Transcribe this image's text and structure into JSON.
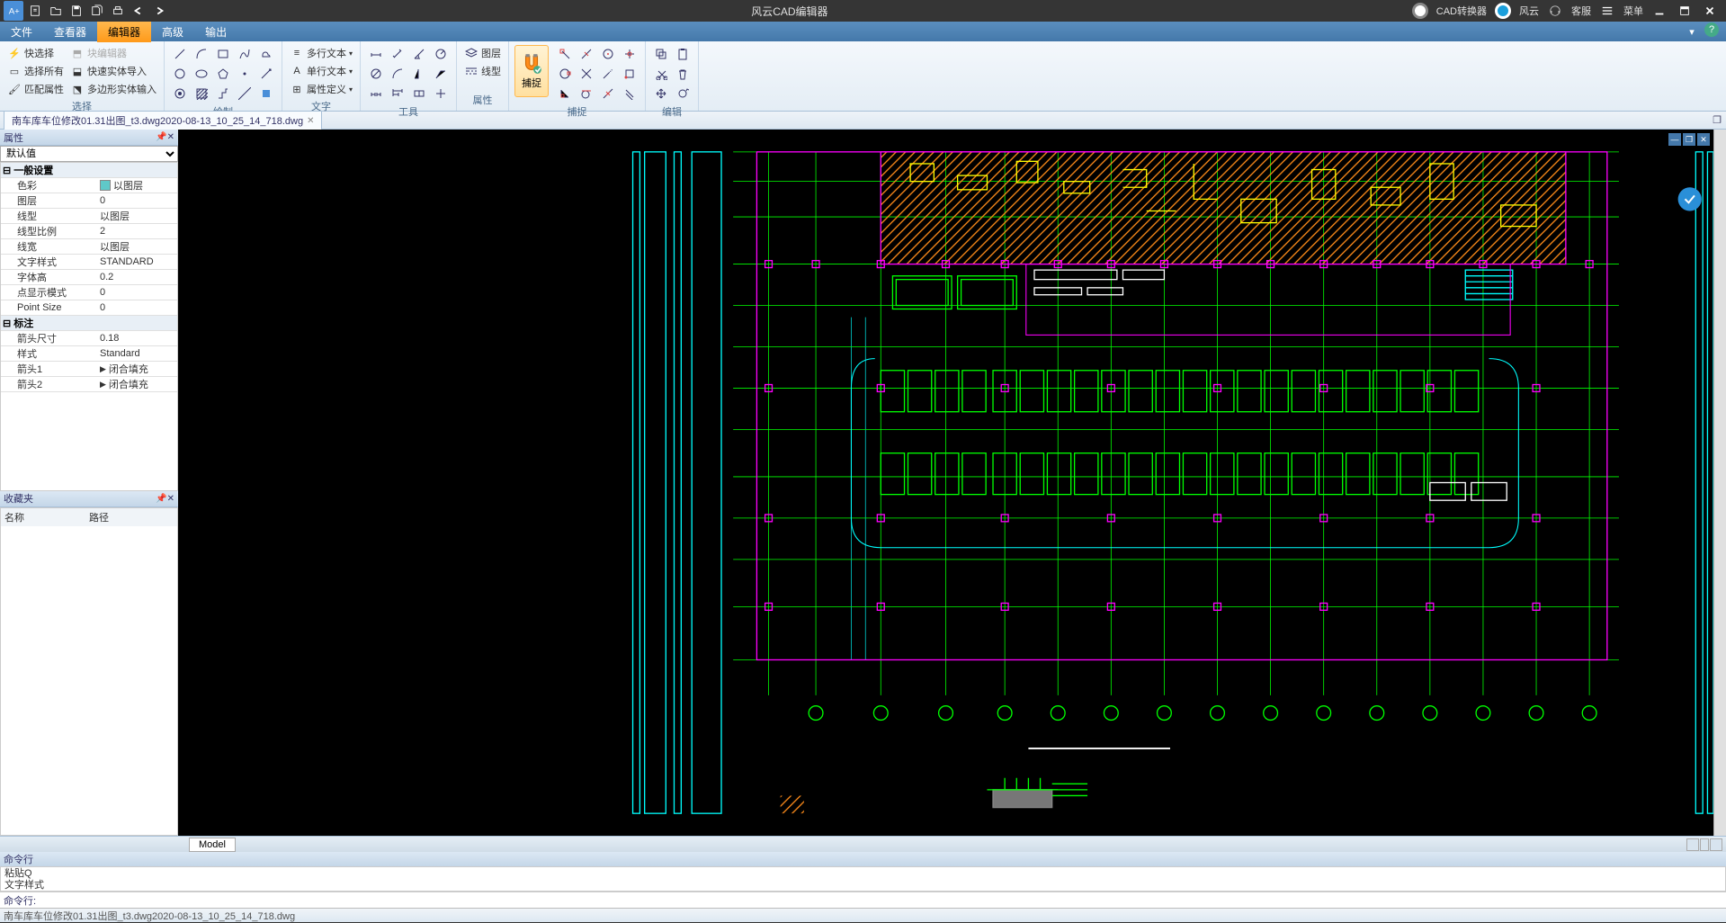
{
  "app": {
    "title": "风云CAD编辑器"
  },
  "titlebar_right": {
    "convert": "CAD转换器",
    "brand": "风云",
    "support": "客服",
    "menu": "菜单"
  },
  "menus": [
    "文件",
    "查看器",
    "编辑器",
    "高级",
    "输出"
  ],
  "active_menu": 2,
  "ribbon": {
    "select": {
      "label": "选择",
      "quick_sel": "快选择",
      "block_edit": "块编辑器",
      "sel_all": "选择所有",
      "quick_entity": "快速实体导入",
      "match_prop": "匹配属性",
      "poly_entity": "多边形实体输入"
    },
    "draw": {
      "label": "绘制"
    },
    "text": {
      "label": "文字",
      "multi": "多行文本",
      "single": "单行文本",
      "attrdef": "属性定义"
    },
    "tools": {
      "label": "工具"
    },
    "props": {
      "label": "属性",
      "layer": "图层",
      "linetype": "线型"
    },
    "snap": {
      "label": "捕捉",
      "btn": "捕捉"
    },
    "edit": {
      "label": "编辑"
    }
  },
  "doc_tab": "南车库车位修改01.31出图_t3.dwg2020-08-13_10_25_14_718.dwg",
  "properties": {
    "title": "属性",
    "default": "默认值",
    "general_section": "一般设置",
    "rows": [
      {
        "k": "色彩",
        "v": "以图层",
        "color": true
      },
      {
        "k": "图层",
        "v": "0"
      },
      {
        "k": "线型",
        "v": "以图层"
      },
      {
        "k": "线型比例",
        "v": "2"
      },
      {
        "k": "线宽",
        "v": "以图层"
      },
      {
        "k": "文字样式",
        "v": "STANDARD"
      },
      {
        "k": "字体高",
        "v": "0.2"
      },
      {
        "k": "点显示模式",
        "v": "0"
      },
      {
        "k": "Point Size",
        "v": "0"
      }
    ],
    "dim_section": "标注",
    "dim_rows": [
      {
        "k": "箭头尺寸",
        "v": "0.18"
      },
      {
        "k": "样式",
        "v": "Standard"
      },
      {
        "k": "箭头1",
        "v": "闭合填充"
      },
      {
        "k": "箭头2",
        "v": "闭合填充"
      }
    ]
  },
  "favorites": {
    "title": "收藏夹",
    "col_name": "名称",
    "col_path": "路径"
  },
  "model_tab": "Model",
  "command": {
    "title": "命令行",
    "line1": "粘贴Q",
    "line2": "文字样式",
    "prompt": "命令行:"
  },
  "status": {
    "file": "南车库车位修改01.31出图_t3.dwg2020-08-13_10_25_14_718.dwg"
  }
}
